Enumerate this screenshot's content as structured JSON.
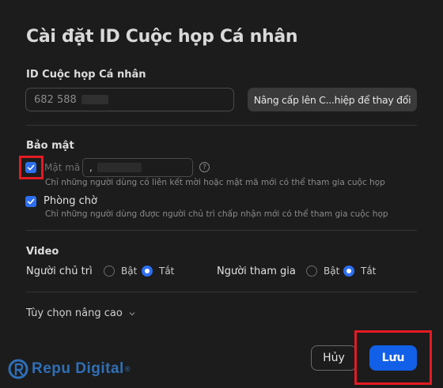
{
  "dialog": {
    "title": "Cài đặt ID Cuộc họp Cá nhân"
  },
  "meeting_id": {
    "section_label": "ID Cuộc họp Cá nhân",
    "value": "682 588",
    "upgrade_label": "Nâng cấp lên C...hiệp để thay đổi"
  },
  "security": {
    "section_label": "Bảo mật",
    "passcode": {
      "label": "Mật mã",
      "value": ",",
      "checked": true,
      "hint": "Chỉ những người dùng có liên kết mời hoặc mật mã mới có thể tham gia cuộc họp"
    },
    "waiting_room": {
      "label": "Phòng chờ",
      "checked": true,
      "hint": "Chỉ những người dùng được người chủ trì chấp nhận mới có thể tham gia cuộc họp"
    },
    "help_glyph": "?"
  },
  "video": {
    "section_label": "Video",
    "host": {
      "label": "Người chủ trì",
      "on_label": "Bật",
      "off_label": "Tắt",
      "selected": "off"
    },
    "participant": {
      "label": "Người tham gia",
      "on_label": "Bật",
      "off_label": "Tắt",
      "selected": "off"
    }
  },
  "advanced": {
    "label": "Tùy chọn nâng cao"
  },
  "footer": {
    "cancel_label": "Hủy",
    "save_label": "Lưu"
  },
  "watermark": {
    "text": "Repu Digital",
    "reg": "®"
  },
  "colors": {
    "accent": "#1160e7",
    "highlight": "#e31b23",
    "background": "#1c1c1c"
  }
}
